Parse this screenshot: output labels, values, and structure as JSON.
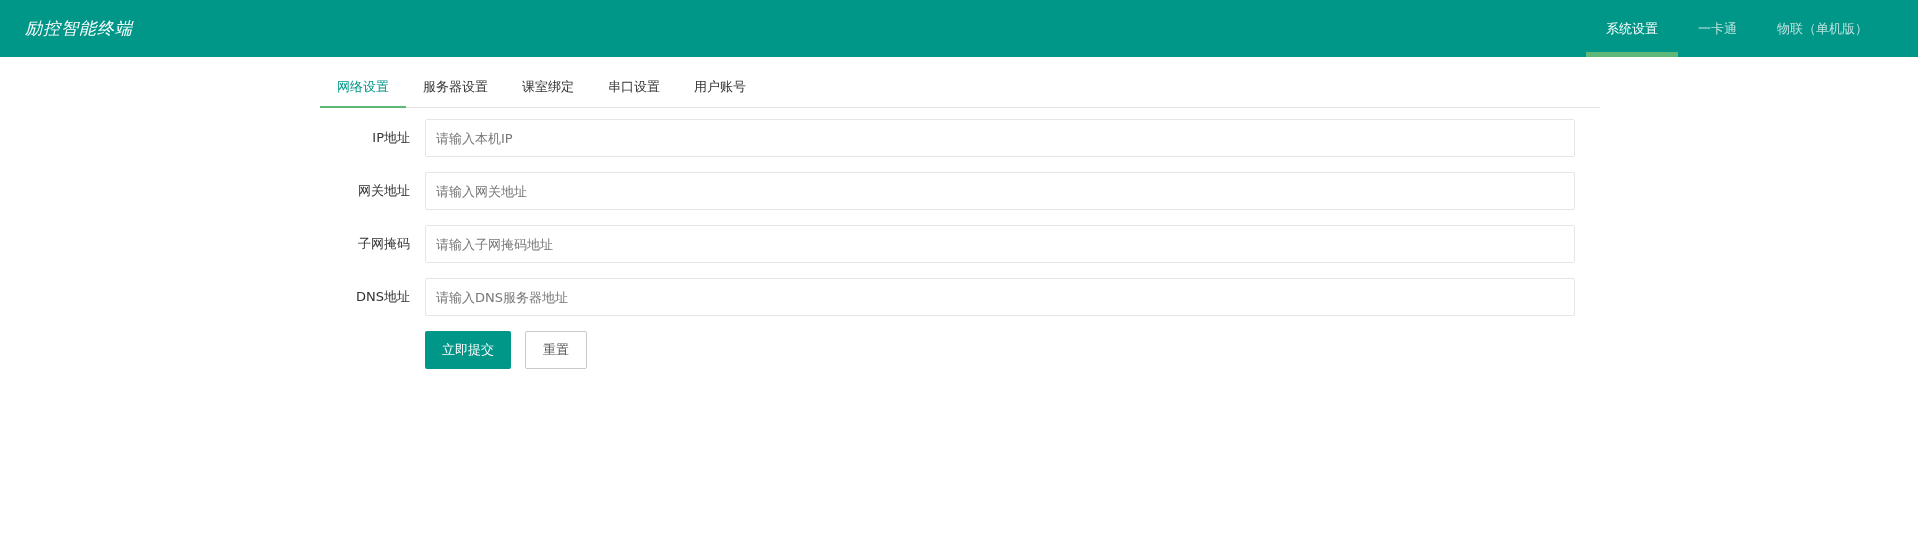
{
  "header": {
    "title": "励控智能终端",
    "nav": [
      {
        "label": "系统设置",
        "selected": true
      },
      {
        "label": "一卡通",
        "selected": false
      },
      {
        "label": "物联（单机版）",
        "selected": false
      }
    ]
  },
  "tabs": [
    {
      "label": "网络设置",
      "selected": true
    },
    {
      "label": "服务器设置",
      "selected": false
    },
    {
      "label": "课室绑定",
      "selected": false
    },
    {
      "label": "串口设置",
      "selected": false
    },
    {
      "label": "用户账号",
      "selected": false
    }
  ],
  "form": {
    "fields": [
      {
        "label": "IP地址",
        "placeholder": "请输入本机IP"
      },
      {
        "label": "网关地址",
        "placeholder": "请输入网关地址"
      },
      {
        "label": "子网掩码",
        "placeholder": "请输入子网掩码地址"
      },
      {
        "label": "DNS地址",
        "placeholder": "请输入DNS服务器地址"
      }
    ],
    "buttons": [
      {
        "label": "立即提交",
        "kind": "primary"
      },
      {
        "label": "重置",
        "kind": "secondary"
      }
    ]
  }
}
